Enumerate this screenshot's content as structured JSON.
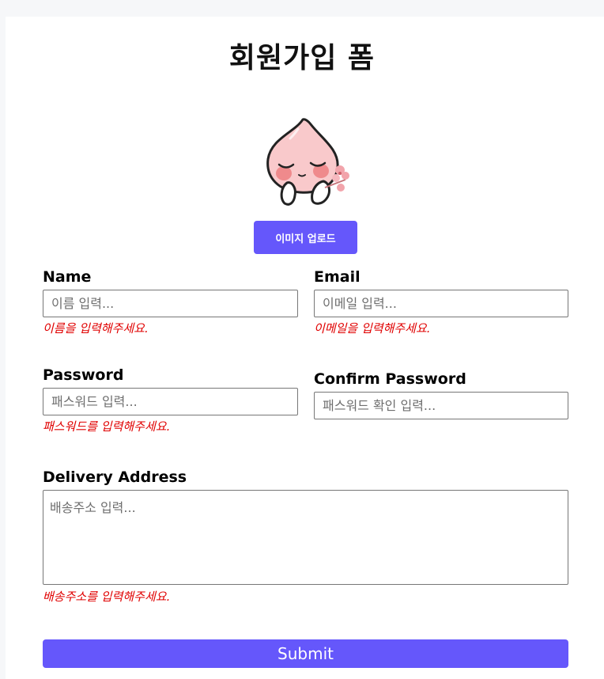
{
  "form": {
    "title": "회원가입 폼",
    "upload_button": "이미지 업로드",
    "submit_button": "Submit"
  },
  "fields": {
    "name": {
      "label": "Name",
      "placeholder": "이름 입력...",
      "error": "이름을 입력해주세요."
    },
    "email": {
      "label": "Email",
      "placeholder": "이메일 입력...",
      "error": "이메일을 입력해주세요."
    },
    "password": {
      "label": "Password",
      "placeholder": "패스워드 입력...",
      "error": "패스워드를 입력해주세요."
    },
    "confirm_password": {
      "label": "Confirm Password",
      "placeholder": "패스워드 확인 입력..."
    },
    "address": {
      "label": "Delivery Address",
      "placeholder": "배송주소 입력...",
      "error": "배송주소를 입력해주세요."
    }
  },
  "colors": {
    "accent": "#6557fb",
    "error": "#e00000",
    "page_background": "#f6f7f9",
    "card_background": "#ffffff"
  },
  "icons": {
    "avatar": "peach-character-avatar"
  }
}
